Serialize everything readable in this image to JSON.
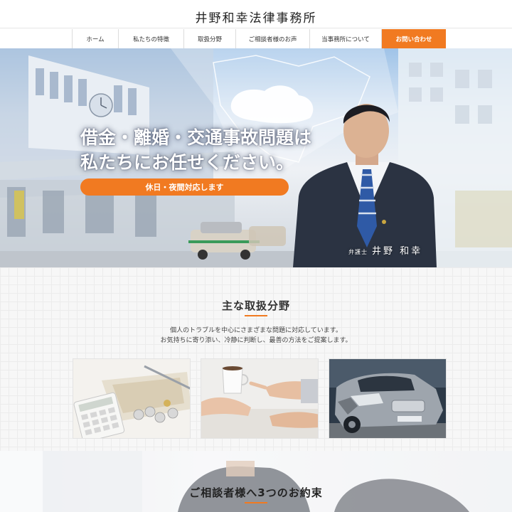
{
  "site": {
    "title": "井野和幸法律事務所"
  },
  "nav": {
    "items": [
      "ホーム",
      "私たちの特徴",
      "取扱分野",
      "ご相談者様のお声",
      "当事務所について"
    ],
    "contact_label": "お問い合わせ"
  },
  "hero": {
    "headline_line1": "借金・離婚・交通事故問題は",
    "headline_line2": "私たちにお任せください。",
    "pill_label": "休日・夜間対応します",
    "lawyer_role": "弁護士",
    "lawyer_name": "井野 和幸"
  },
  "services": {
    "heading": "主な取扱分野",
    "lead_line1": "個人のトラブルを中心にさまざまな問題に対応しています。",
    "lead_line2": "お気持ちに寄り添い、冷静に判断し、最善の方法をご提案します。"
  },
  "promise": {
    "heading": "ご相談者様へ3つのお約束"
  },
  "colors": {
    "accent": "#f17a21",
    "text": "#333333",
    "navy_suit": "#2b3342"
  }
}
